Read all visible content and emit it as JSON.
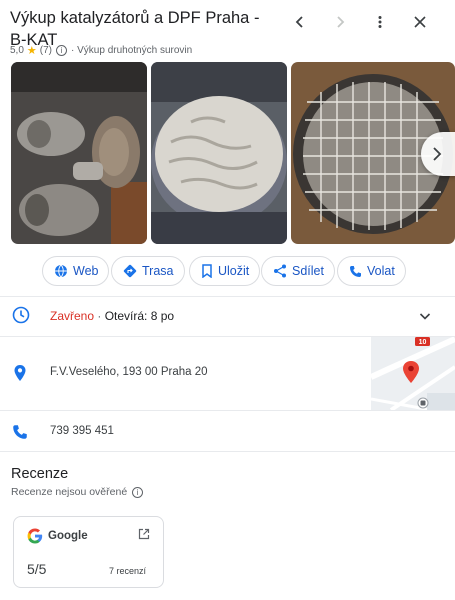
{
  "header": {
    "title": "Výkup katalyzátorů a DPF Praha - B-KAT",
    "rating": "5,0",
    "review_count": "(7)",
    "category": "Výkup druhotných surovin",
    "back_icon": "chevron-left-icon",
    "forward_icon": "chevron-right-icon",
    "menu_icon": "more-vert-icon",
    "close_icon": "close-icon"
  },
  "actions": [
    {
      "label": "Web",
      "icon": "globe-icon"
    },
    {
      "label": "Trasa",
      "icon": "directions-icon"
    },
    {
      "label": "Uložit",
      "icon": "bookmark-icon"
    },
    {
      "label": "Sdílet",
      "icon": "share-icon"
    },
    {
      "label": "Volat",
      "icon": "phone-icon"
    }
  ],
  "hours": {
    "status": "Zavřeno",
    "separator": " · ",
    "opens": "Otevírá: 8 po"
  },
  "address": "F.V.Veselého, 193 00 Praha 20",
  "map": {
    "road_badge": "10"
  },
  "phone": "739 395 451",
  "reviews": {
    "title": "Recenze",
    "subtitle": "Recenze nejsou ověřené",
    "source": "Google",
    "score": "5/5",
    "count": "7 recenzí"
  },
  "colors": {
    "accent": "#1a73e8",
    "closed": "#d93025",
    "star": "#f5b400"
  }
}
